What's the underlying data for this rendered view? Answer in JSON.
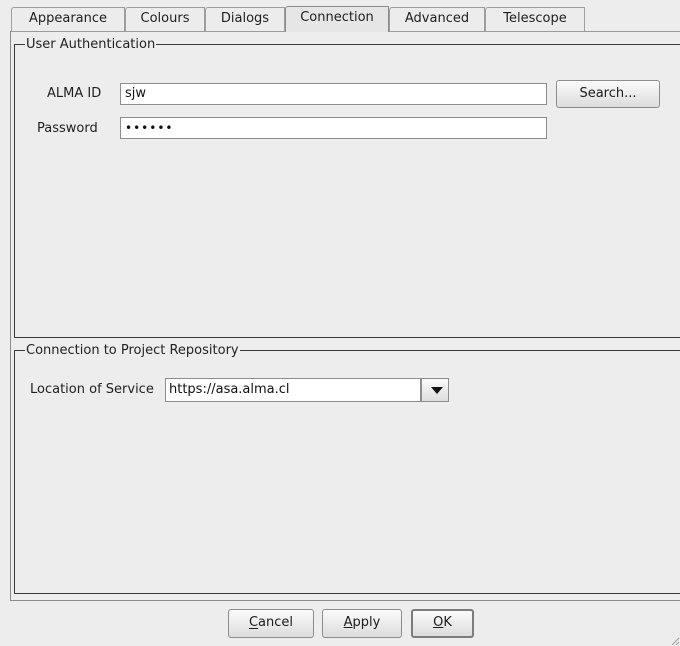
{
  "tabs": [
    {
      "label": "Appearance"
    },
    {
      "label": "Colours"
    },
    {
      "label": "Dialogs"
    },
    {
      "label": "Connection",
      "active": true
    },
    {
      "label": "Advanced"
    },
    {
      "label": "Telescope"
    }
  ],
  "auth": {
    "title": "User Authentication",
    "alma_id_label": "ALMA ID",
    "alma_id_value": "sjw",
    "search_label": "Search...",
    "password_label": "Password",
    "password_value": "••••••"
  },
  "repository": {
    "title": "Connection to Project Repository",
    "location_label": "Location of Service",
    "location_value": "https://asa.alma.cl"
  },
  "footer": {
    "cancel_label": "Cancel",
    "apply_label": "Apply",
    "ok_label": "OK"
  },
  "icons": {
    "combo_arrow": "chevron-down-icon",
    "resize_grip": "resize-grip-icon"
  }
}
